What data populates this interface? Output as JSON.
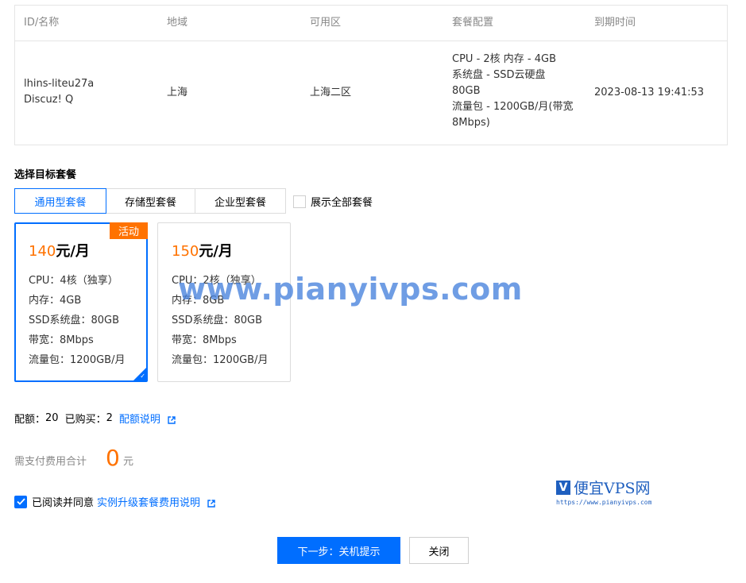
{
  "instance_table": {
    "headers": [
      "ID/名称",
      "地域",
      "可用区",
      "套餐配置",
      "到期时间"
    ],
    "row": {
      "id": "lhins-liteu27a",
      "name": "Discuz! Q",
      "region": "上海",
      "zone": "上海二区",
      "config_lines": [
        "CPU - 2核 内存 - 4GB",
        "系统盘 - SSD云硬盘",
        "80GB",
        "流量包 - 1200GB/月(带宽",
        "8Mbps)"
      ],
      "expire": "2023-08-13 19:41:53"
    }
  },
  "select_plan": {
    "title": "选择目标套餐",
    "tabs": [
      {
        "label": "通用型套餐",
        "active": true
      },
      {
        "label": "存储型套餐",
        "active": false
      },
      {
        "label": "企业型套餐",
        "active": false
      }
    ],
    "show_all_label": "展示全部套餐"
  },
  "plans": [
    {
      "price": "140",
      "unit": "元/月",
      "badge": "活动",
      "selected": true,
      "specs": [
        "CPU：4核（独享）",
        "内存：4GB",
        "SSD系统盘：80GB",
        "带宽：8Mbps",
        "流量包：1200GB/月"
      ]
    },
    {
      "price": "150",
      "unit": "元/月",
      "badge": "",
      "selected": false,
      "specs": [
        "CPU：2核（独享）",
        "内存：8GB",
        "SSD系统盘：80GB",
        "带宽：8Mbps",
        "流量包：1200GB/月"
      ]
    }
  ],
  "quota": {
    "quota_label": "配额：",
    "quota_value": "20",
    "bought_label": "已购买：",
    "bought_value": "2",
    "link": "配额说明"
  },
  "total": {
    "label": "需支付费用合计",
    "value": "0",
    "unit": "元"
  },
  "agreement": {
    "text": "已阅读并同意",
    "link": "实例升级套餐费用说明",
    "checked": true
  },
  "buttons": {
    "next": "下一步：关机提示",
    "close": "关闭"
  },
  "watermark": {
    "domain": "www.pianyivps.com",
    "brand": "便宜VPS网",
    "url": "https://www.pianyivps.com"
  },
  "colors": {
    "primary": "#006eff",
    "accent_orange": "#ff7200",
    "muted_text": "#888888",
    "border": "#e5e5e5"
  }
}
